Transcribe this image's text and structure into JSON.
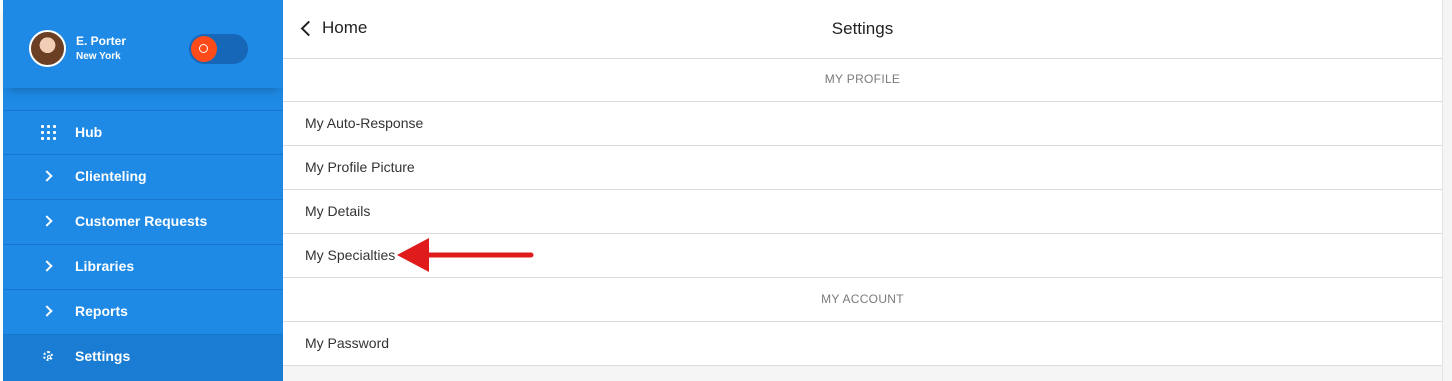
{
  "user": {
    "name": "E. Porter",
    "location": "New York"
  },
  "sidebar": {
    "items": [
      {
        "label": "Hub",
        "icon": "grid-icon"
      },
      {
        "label": "Clienteling",
        "icon": "chevron-right-icon"
      },
      {
        "label": "Customer Requests",
        "icon": "chevron-right-icon"
      },
      {
        "label": "Libraries",
        "icon": "chevron-right-icon"
      },
      {
        "label": "Reports",
        "icon": "chevron-right-icon"
      },
      {
        "label": "Settings",
        "icon": "gear-icon",
        "active": true
      }
    ]
  },
  "header": {
    "back_label": "Home",
    "title": "Settings"
  },
  "sections": {
    "profile": {
      "heading": "MY PROFILE",
      "items": [
        "My Auto-Response",
        "My Profile Picture",
        "My Details",
        "My Specialties"
      ]
    },
    "account": {
      "heading": "MY ACCOUNT",
      "items": [
        "My Password"
      ]
    }
  },
  "colors": {
    "sidebar": "#1e8ae6",
    "toggle_knob": "#ff4a1a",
    "annotation_arrow": "#e01b1b"
  }
}
